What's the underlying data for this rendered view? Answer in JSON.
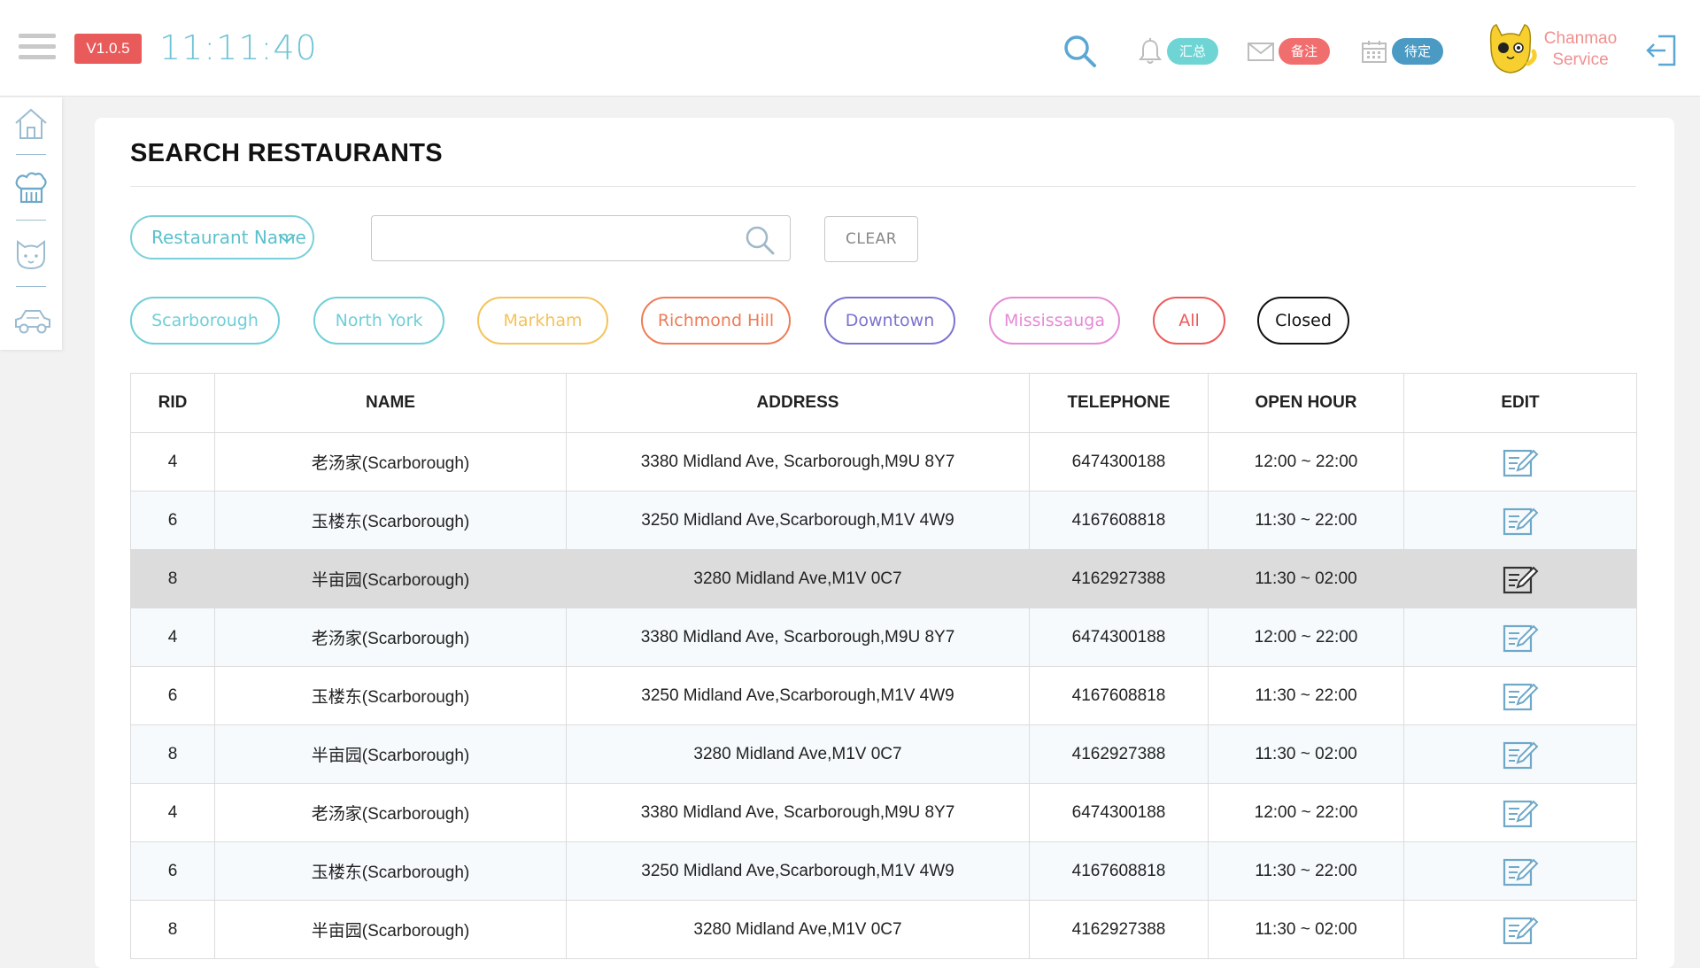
{
  "app": {
    "version": "V1.0.5",
    "clock": "11:11:40",
    "notifications": [
      {
        "id": "bell",
        "icon": "bell-icon",
        "label": "汇总",
        "color": "#6fd4d4"
      },
      {
        "id": "mail",
        "icon": "mail-icon",
        "label": "备注",
        "color": "#f06e6e"
      },
      {
        "id": "calendar",
        "icon": "calendar-icon",
        "label": "待定",
        "color": "#4a9ac4"
      }
    ],
    "user": {
      "line1": "Chanmao",
      "line2": "Service"
    }
  },
  "sidebar": {
    "items": [
      {
        "name": "home-icon"
      },
      {
        "name": "chef-hat-icon"
      },
      {
        "name": "cat-icon"
      },
      {
        "name": "car-icon"
      }
    ]
  },
  "page": {
    "title": "SEARCH RESTAURANTS",
    "filter_select": "Restaurant Name",
    "search_value": "",
    "clear_label": "CLEAR"
  },
  "areas": [
    {
      "label": "Scarborough",
      "color": "#6fcfd8"
    },
    {
      "label": "North York",
      "color": "#6fcfd8"
    },
    {
      "label": "Markham",
      "color": "#f4c35a"
    },
    {
      "label": "Richmond Hill",
      "color": "#ee7c55"
    },
    {
      "label": "Downtown",
      "color": "#7b73cf"
    },
    {
      "label": "Mississauga",
      "color": "#e58ad6"
    },
    {
      "label": "All",
      "color": "#ec5a5a"
    },
    {
      "label": "Closed",
      "color": "#111111"
    }
  ],
  "table": {
    "headers": [
      "RID",
      "NAME",
      "ADDRESS",
      "TELEPHONE",
      "OPEN HOUR",
      "EDIT"
    ],
    "rows": [
      {
        "rid": "4",
        "name": "老汤家(Scarborough)",
        "address": "3380 Midland Ave, Scarborough,M9U 8Y7",
        "phone": "6474300188",
        "hours": "12:00 ~ 22:00"
      },
      {
        "rid": "6",
        "name": "玉楼东(Scarborough)",
        "address": "3250 Midland Ave,Scarborough,M1V 4W9",
        "phone": "4167608818",
        "hours": "11:30 ~ 22:00"
      },
      {
        "rid": "8",
        "name": "半亩园(Scarborough)",
        "address": "3280 Midland Ave,M1V 0C7",
        "phone": "4162927388",
        "hours": "11:30 ~ 02:00"
      },
      {
        "rid": "4",
        "name": "老汤家(Scarborough)",
        "address": "3380 Midland Ave, Scarborough,M9U 8Y7",
        "phone": "6474300188",
        "hours": "12:00 ~ 22:00"
      },
      {
        "rid": "6",
        "name": "玉楼东(Scarborough)",
        "address": "3250 Midland Ave,Scarborough,M1V 4W9",
        "phone": "4167608818",
        "hours": "11:30 ~ 22:00"
      },
      {
        "rid": "8",
        "name": "半亩园(Scarborough)",
        "address": "3280 Midland Ave,M1V 0C7",
        "phone": "4162927388",
        "hours": "11:30 ~ 02:00"
      },
      {
        "rid": "4",
        "name": "老汤家(Scarborough)",
        "address": "3380 Midland Ave, Scarborough,M9U 8Y7",
        "phone": "6474300188",
        "hours": "12:00 ~ 22:00"
      },
      {
        "rid": "6",
        "name": "玉楼东(Scarborough)",
        "address": "3250 Midland Ave,Scarborough,M1V 4W9",
        "phone": "4167608818",
        "hours": "11:30 ~ 22:00"
      },
      {
        "rid": "8",
        "name": "半亩园(Scarborough)",
        "address": "3280 Midland Ave,M1V 0C7",
        "phone": "4162927388",
        "hours": "11:30 ~ 02:00"
      }
    ],
    "selected_row": 2
  }
}
